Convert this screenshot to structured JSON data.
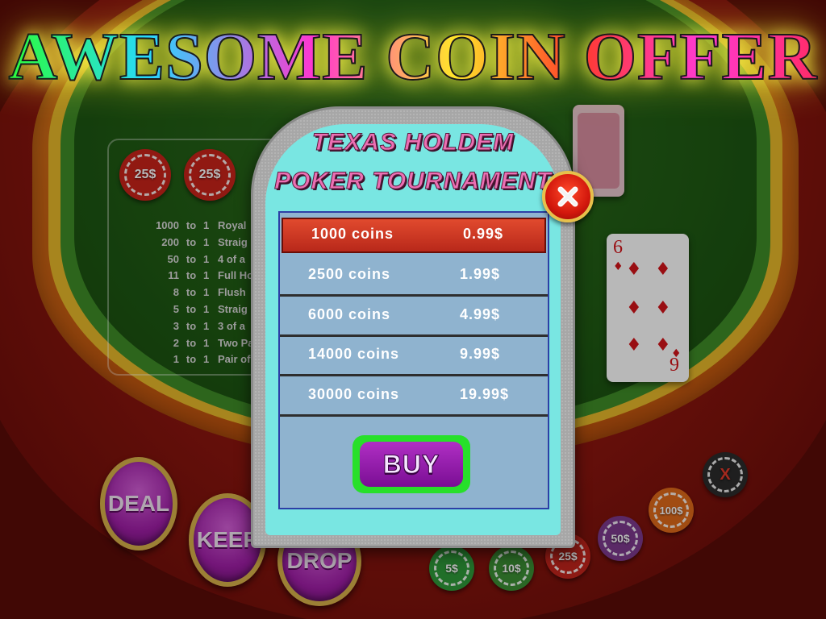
{
  "headline": "AWESOME COIN OFFER",
  "dialog": {
    "title_line1": "TEXAS HOLDEM",
    "title_line2": "POKER TOURNAMENT",
    "offers": [
      {
        "coins": "1000 coins",
        "price": "0.99$",
        "selected": true
      },
      {
        "coins": "2500 coins",
        "price": "1.99$",
        "selected": false
      },
      {
        "coins": "6000 coins",
        "price": "4.99$",
        "selected": false
      },
      {
        "coins": "14000 coins",
        "price": "9.99$",
        "selected": false
      },
      {
        "coins": "30000 coins",
        "price": "19.99$",
        "selected": false
      }
    ],
    "buy_label": "BUY",
    "close_icon": "close-x-icon"
  },
  "paytable": [
    {
      "mult": "1000",
      "to": "to",
      "one": "1",
      "hand": "Royal"
    },
    {
      "mult": "200",
      "to": "to",
      "one": "1",
      "hand": "Straig"
    },
    {
      "mult": "50",
      "to": "to",
      "one": "1",
      "hand": "4 of a"
    },
    {
      "mult": "11",
      "to": "to",
      "one": "1",
      "hand": "Full Ho"
    },
    {
      "mult": "8",
      "to": "to",
      "one": "1",
      "hand": "Flush"
    },
    {
      "mult": "5",
      "to": "to",
      "one": "1",
      "hand": "Straig"
    },
    {
      "mult": "3",
      "to": "to",
      "one": "1",
      "hand": "3 of a"
    },
    {
      "mult": "2",
      "to": "to",
      "one": "1",
      "hand": "Two Pa"
    },
    {
      "mult": "1",
      "to": "to",
      "one": "1",
      "hand": "Pair of"
    }
  ],
  "bet_chips": [
    "25$",
    "25$"
  ],
  "buttons": {
    "deal": "DEAL",
    "keep": "KEEP",
    "drop": "DROP"
  },
  "chips": [
    {
      "label": "5$",
      "color": "#2f9a3a"
    },
    {
      "label": "10$",
      "color": "#3b8f34"
    },
    {
      "label": "25$",
      "color": "#c4251c"
    },
    {
      "label": "50$",
      "color": "#7d3a8e"
    },
    {
      "label": "100$",
      "color": "#e06a1a"
    },
    {
      "label": "X",
      "color": "#2b2b2b"
    }
  ],
  "card": {
    "rank": "6",
    "rank_flipped": "9",
    "suit": "♦"
  },
  "colors": {
    "felt": "#1f5a13",
    "dialog_bg": "#79e6e2",
    "row_selected": "#d2351f",
    "buy_green": "#27e02a"
  }
}
